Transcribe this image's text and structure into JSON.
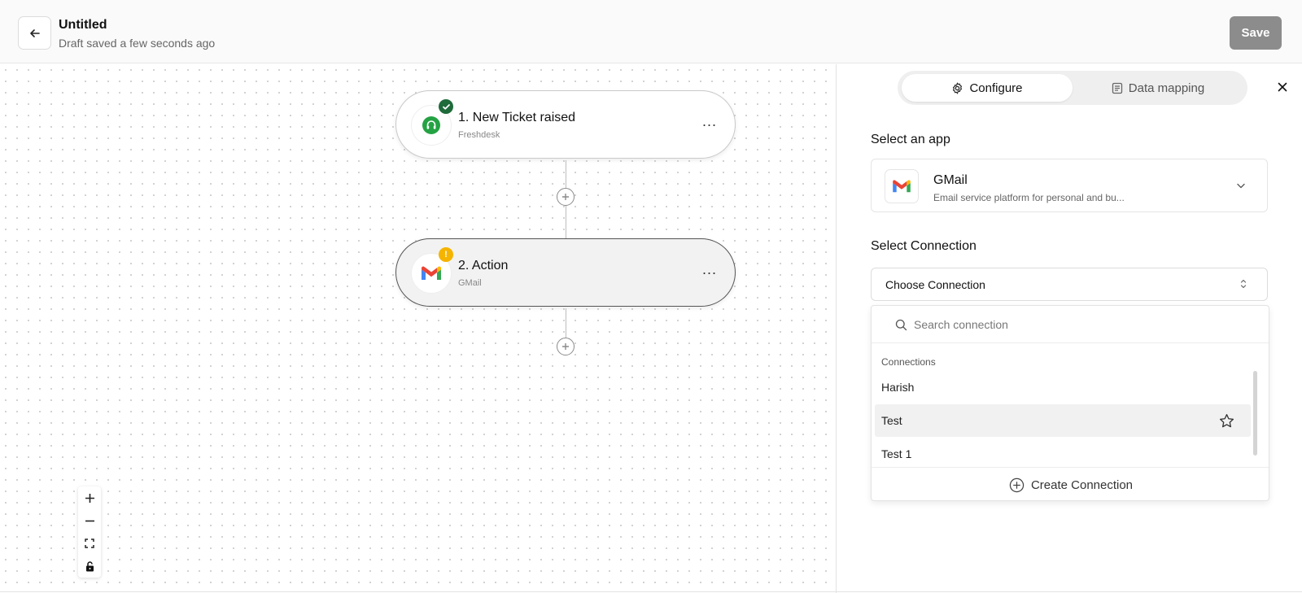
{
  "header": {
    "title": "Untitled",
    "subtitle": "Draft saved a few seconds ago",
    "save_label": "Save",
    "back_icon": "arrow-left-icon"
  },
  "canvas": {
    "nodes": [
      {
        "title": "1. New Ticket raised",
        "subtitle": "Freshdesk",
        "status": "success",
        "icon": "freshdesk-headset-icon"
      },
      {
        "title": "2. Action",
        "subtitle": "GMail",
        "status": "warning",
        "icon": "gmail-icon",
        "warning_symbol": "!"
      }
    ],
    "node_menu_label": "...",
    "zoom_controls": [
      "zoom-in",
      "zoom-out",
      "fit-view",
      "lock"
    ]
  },
  "panel": {
    "tabs": [
      {
        "label": "Configure",
        "icon": "gear-icon",
        "active": true
      },
      {
        "label": "Data mapping",
        "icon": "document-icon",
        "active": false
      }
    ],
    "select_app_label": "Select an app",
    "app": {
      "name": "GMail",
      "description": "Email service platform for personal and bu..."
    },
    "select_connection_label": "Select Connection",
    "connection_select": {
      "value": "Choose Connection"
    },
    "dropdown": {
      "search_placeholder": "Search connection",
      "group_label": "Connections",
      "items": [
        "Harish",
        "Test",
        "Test 1"
      ],
      "hovered_index": 1,
      "create_label": "Create Connection"
    }
  },
  "colors": {
    "save_disabled": "#8c8c8c",
    "success_badge": "#1f6b3a",
    "warning_badge": "#f5b400",
    "freshdesk_green": "#25a244",
    "gmail_red": "#ea4335",
    "gmail_blue": "#4285f4",
    "gmail_green": "#34a853",
    "gmail_yellow": "#fbbc04"
  }
}
